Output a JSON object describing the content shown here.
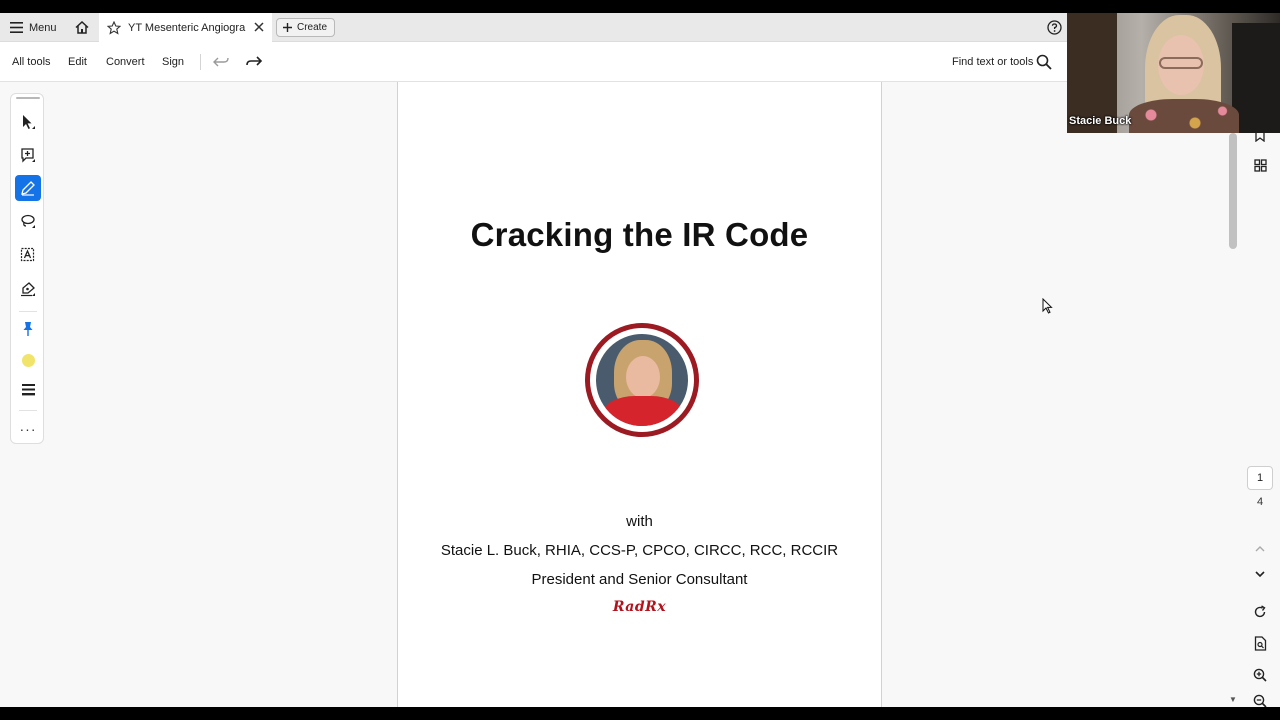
{
  "tabbar": {
    "menu_label": "Menu",
    "doc_tab_title": "YT Mesenteric Angiogra...",
    "create_label": "Create"
  },
  "toolbar": {
    "all_tools": "All tools",
    "edit": "Edit",
    "convert": "Convert",
    "sign": "Sign",
    "find_label": "Find text or tools"
  },
  "left_rail": {
    "tools": [
      "select-tool",
      "add-comment-tool",
      "highlight-tool",
      "draw-freeform-tool",
      "add-text-tool",
      "fill-sign-tool",
      "pin-tool",
      "color-picker",
      "line-weight-tool",
      "more-tools"
    ],
    "active_tool": "highlight-tool",
    "color": "#f0e46a"
  },
  "document": {
    "title": "Cracking the IR Code",
    "with": "with",
    "author": "Stacie L. Buck, RHIA, CCS-P, CPCO, CIRCC, RCC, RCCIR",
    "role": "President and Senior Consultant",
    "logo_text": "RadRx"
  },
  "right_rail": {
    "current_page": "1",
    "total_pages": "4"
  },
  "webcam": {
    "name": "Stacie Buck"
  },
  "colors": {
    "accent": "#1473e6",
    "logo_red": "#b3121c",
    "photo_ring": "#9c1a21"
  }
}
